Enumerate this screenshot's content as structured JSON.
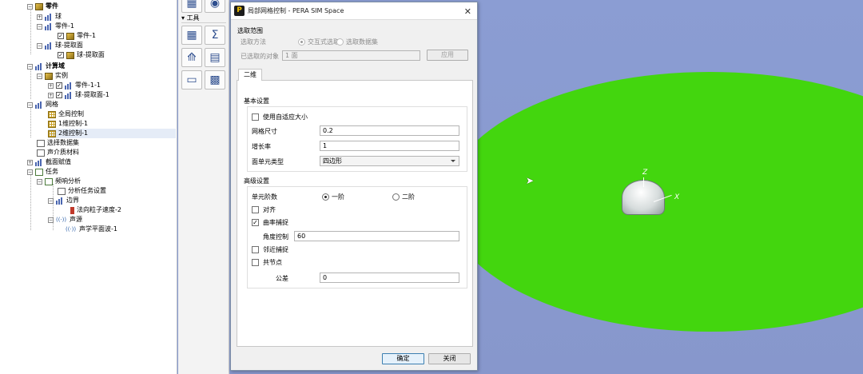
{
  "tree": {
    "items": [
      {
        "label": "零件",
        "bold": true
      },
      {
        "label": "球"
      },
      {
        "label": "零件-1"
      },
      {
        "label": "零件-1"
      },
      {
        "label": "球-提取面"
      },
      {
        "label": "球-提取面"
      },
      {
        "label": "计算域",
        "bold": true
      },
      {
        "label": "实例"
      },
      {
        "label": "零件-1-1"
      },
      {
        "label": "球-提取面-1"
      },
      {
        "label": "网格"
      },
      {
        "label": "全局控制"
      },
      {
        "label": "1维控制-1"
      },
      {
        "label": "2维控制-1"
      },
      {
        "label": "选择数据集"
      },
      {
        "label": "声介质材料"
      },
      {
        "label": "截面赋值"
      },
      {
        "label": "任务"
      },
      {
        "label": "频响分析"
      },
      {
        "label": "分析任务设置"
      },
      {
        "label": "边界"
      },
      {
        "label": "法向粒子速度-2"
      },
      {
        "label": "声源"
      },
      {
        "label": "声学平面波-1"
      }
    ]
  },
  "tools": {
    "title": "工具",
    "buttons": [
      {
        "icon": "mesh-grid-icon",
        "glyph": "▦"
      },
      {
        "icon": "sigma-icon",
        "glyph": "Σ"
      },
      {
        "icon": "mesh-transform-icon",
        "glyph": "⟰"
      },
      {
        "icon": "ruler-icon",
        "glyph": "▤"
      },
      {
        "icon": "table-view-icon",
        "glyph": "▭"
      },
      {
        "icon": "grid-dots-icon",
        "glyph": "▩"
      }
    ]
  },
  "dialog": {
    "title": "局部网格控制 - PERA SIM Space",
    "logo_glyph": "P",
    "close_glyph": "✕",
    "selection": {
      "section_label": "选取范围",
      "method_label": "选取方法",
      "option_interactive": "交互式选取",
      "option_dataset": "选取数据集",
      "selected_label": "已选取的对象",
      "selected_value": "1 面",
      "apply_label": "应用"
    },
    "tab_label": "二维",
    "basic": {
      "section_label": "基本设置",
      "adaptive_label": "使用自适应大小",
      "mesh_size_label": "网格尺寸",
      "mesh_size_value": "0.2",
      "growth_label": "增长率",
      "growth_value": "1",
      "element_type_label": "面单元类型",
      "element_type_value": "四边形"
    },
    "advanced": {
      "section_label": "高级设置",
      "order_label": "单元阶数",
      "order_first": "一阶",
      "order_second": "二阶",
      "symmetry_label": "对齐",
      "curvature_label": "曲率捕捉",
      "angle_label": "角度控制",
      "angle_value": "60",
      "proximity_label": "邻近捕捉",
      "shared_nodes_label": "共节点",
      "tolerance_label": "公差",
      "tolerance_value": "0"
    },
    "ok_label": "确定",
    "close_label": "关闭"
  },
  "viewport": {
    "axis_z": "Z",
    "axis_x": "X",
    "plane_color": "#43d60e",
    "background_color": "#8b9dd1"
  }
}
